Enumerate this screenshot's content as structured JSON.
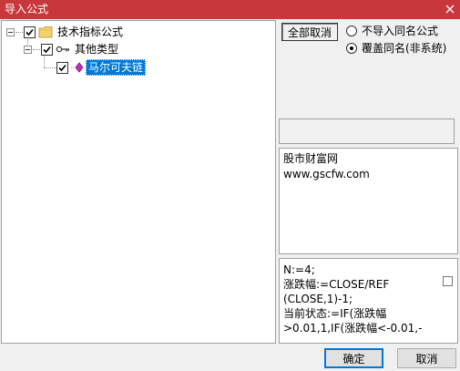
{
  "window": {
    "title": "导入公式"
  },
  "tree": {
    "root": {
      "label": "技术指标公式",
      "checked": true,
      "icon": "folder-icon"
    },
    "group": {
      "label": "其他类型",
      "checked": true,
      "icon": "key-icon"
    },
    "item": {
      "label": "马尔可夫链",
      "checked": true,
      "icon": "formula-icon",
      "selected": true
    }
  },
  "buttons": {
    "deselect_all": "全部取消",
    "ok": "确定",
    "cancel": "取消"
  },
  "options": {
    "no_import_same": "不导入同名公式",
    "overwrite_same": "覆盖同名(非系统)",
    "selected": "overwrite_same"
  },
  "info": {
    "line1": "股市财富网",
    "line2": "www.gscfw.com"
  },
  "formula": {
    "lines": [
      "N:=4;",
      "涨跌幅:=CLOSE/REF",
      "(CLOSE,1)-1;",
      "当前状态:=IF(涨跌幅",
      ">0.01,1,IF(涨跌幅<-0.01,-"
    ],
    "checked": false
  },
  "colors": {
    "titlebar": "#c8373b",
    "selection": "#0078d7"
  }
}
